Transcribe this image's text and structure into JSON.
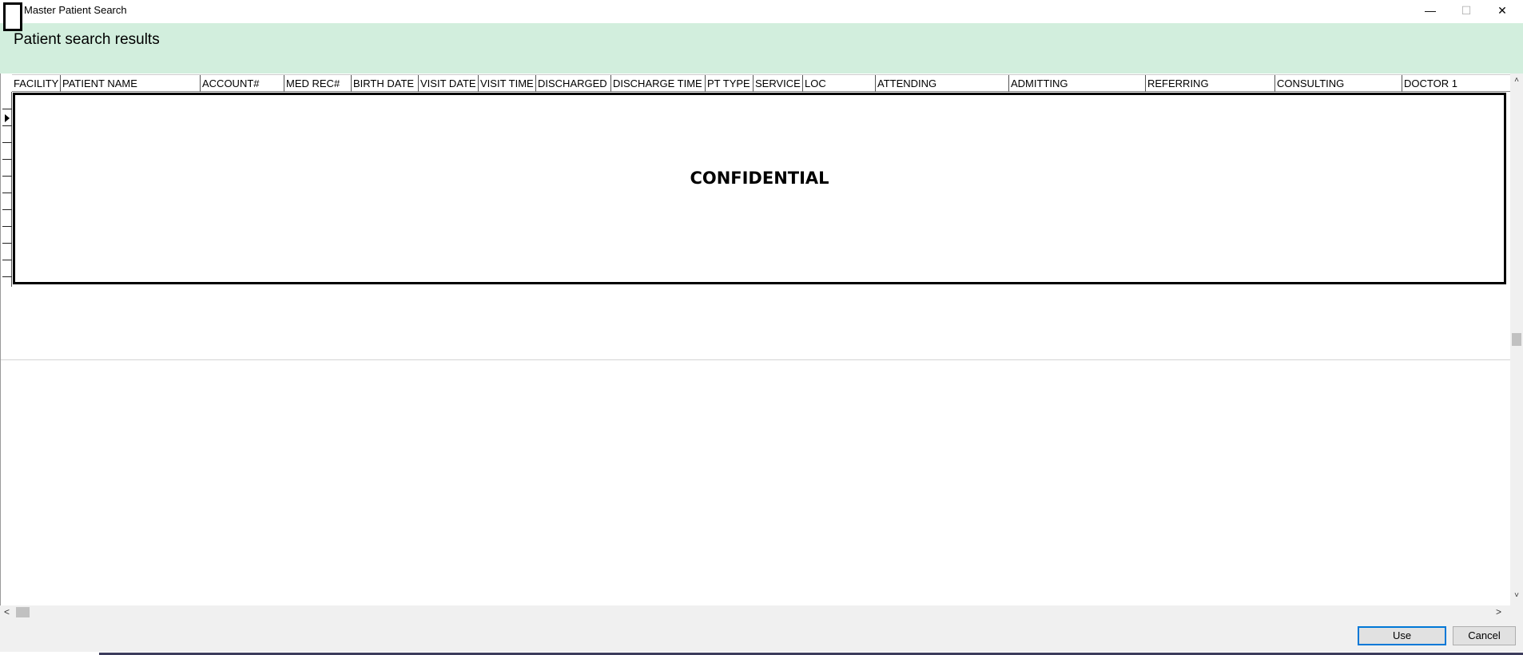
{
  "window": {
    "title": "Master Patient Search",
    "controls": {
      "minimize": "—",
      "maximize": "☐",
      "close": "✕"
    }
  },
  "header": {
    "title": "Patient search results"
  },
  "grid": {
    "columns": [
      "FACILITY",
      "PATIENT NAME",
      "ACCOUNT#",
      "MED REC#",
      "BIRTH DATE",
      "VISIT DATE",
      "VISIT TIME",
      "DISCHARGED",
      "DISCHARGE TIME",
      "PT TYPE",
      "SERVICE",
      "LOC",
      "ATTENDING",
      "ADMITTING",
      "REFERRING",
      "CONSULTING",
      "DOCTOR 1"
    ],
    "redaction_label": "CONFIDENTIAL"
  },
  "scrollbars": {
    "up": "˄",
    "down": "˅",
    "left": "<",
    "right": ">"
  },
  "footer": {
    "use_label": "Use",
    "cancel_label": "Cancel"
  }
}
